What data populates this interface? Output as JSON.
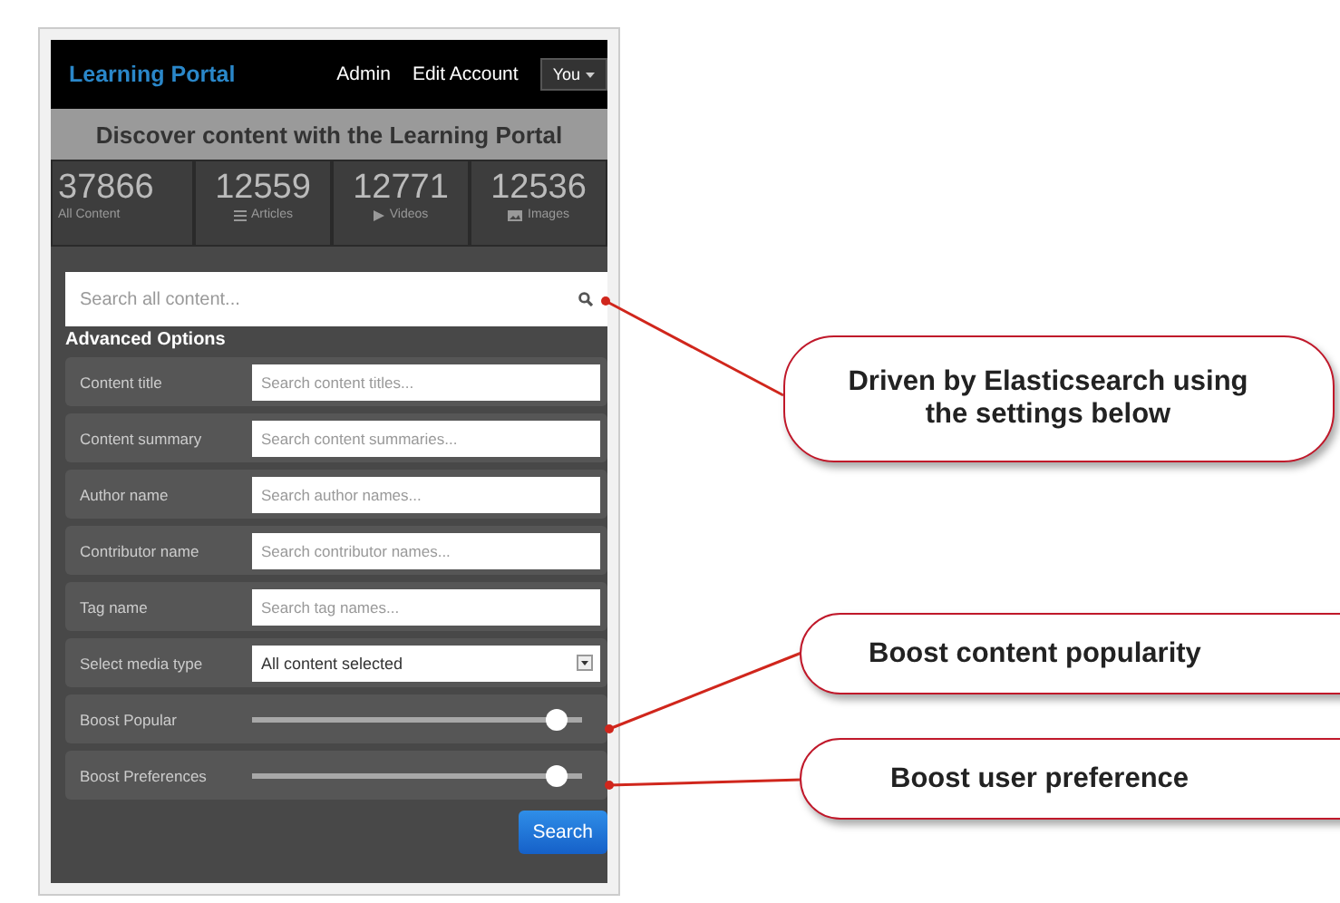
{
  "navbar": {
    "brand": "Learning Portal",
    "links": [
      "Admin",
      "Edit Account"
    ],
    "user_menu": "You"
  },
  "banner": "Discover content with the Learning Portal",
  "stats": [
    {
      "kind": "total",
      "count": "37866",
      "label": "All Content"
    },
    {
      "kind": "articles",
      "count": "12559",
      "label": "Articles"
    },
    {
      "kind": "videos",
      "count": "12771",
      "label": "Videos"
    },
    {
      "kind": "images",
      "count": "12536",
      "label": "Images"
    }
  ],
  "search": {
    "placeholder": "Search all content..."
  },
  "advanced_title": "Advanced Options",
  "fields": [
    {
      "kind": "text",
      "label": "Content title",
      "placeholder": "Search content titles..."
    },
    {
      "kind": "text",
      "label": "Content summary",
      "placeholder": "Search content summaries..."
    },
    {
      "kind": "text",
      "label": "Author name",
      "placeholder": "Search author names..."
    },
    {
      "kind": "text",
      "label": "Contributor name",
      "placeholder": "Search contributor names..."
    },
    {
      "kind": "text",
      "label": "Tag name",
      "placeholder": "Search tag names..."
    },
    {
      "kind": "select",
      "label": "Select media type",
      "value": "All content selected"
    },
    {
      "kind": "slider",
      "label": "Boost Popular",
      "level": 0.95
    },
    {
      "kind": "slider",
      "label": "Boost Preferences",
      "level": 0.95
    }
  ],
  "search_button": "Search",
  "callouts": [
    "Driven by Elasticsearch using the settings below",
    "Boost content popularity",
    "Boost user preference"
  ]
}
